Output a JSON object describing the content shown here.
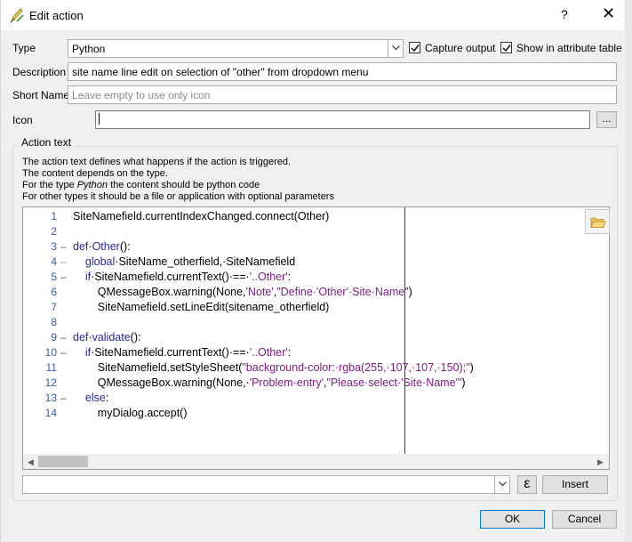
{
  "window": {
    "title": "Edit action",
    "help_label": "?",
    "close_label": "✕"
  },
  "form": {
    "type_label": "Type",
    "type_value": "Python",
    "capture_output_label": "Capture output",
    "capture_output_checked": true,
    "show_attr_label": "Show in attribute table",
    "show_attr_checked": true,
    "description_label": "Description",
    "description_value": "site name line edit on selection of \"other\" from dropdown menu",
    "shortname_label": "Short Name",
    "shortname_placeholder": "Leave empty to use only icon",
    "icon_label": "Icon",
    "icon_value": "",
    "browse_label": "..."
  },
  "action_text": {
    "group_title": "Action text",
    "desc1": "The action text defines what happens if the action is triggered.",
    "desc2": "The content depends on the type.",
    "desc3_pre": "For the type ",
    "desc3_em": "Python",
    "desc3_post": " the content should be python code",
    "desc4": "For other types it should be a file or application with optional parameters"
  },
  "editor": {
    "line_numbers": [
      "1",
      "2",
      "3",
      "4",
      "5",
      "6",
      "7",
      "8",
      "9",
      "10",
      "11",
      "12",
      "13",
      "14"
    ]
  },
  "bottom": {
    "insert_label": "Insert",
    "expression_icon": "ε",
    "ok_label": "OK",
    "cancel_label": "Cancel"
  },
  "colors": {
    "keyword": "#2a2aa0",
    "string": "#7d1f82",
    "line_number": "#3d5aa0",
    "margin": "#a01818"
  }
}
